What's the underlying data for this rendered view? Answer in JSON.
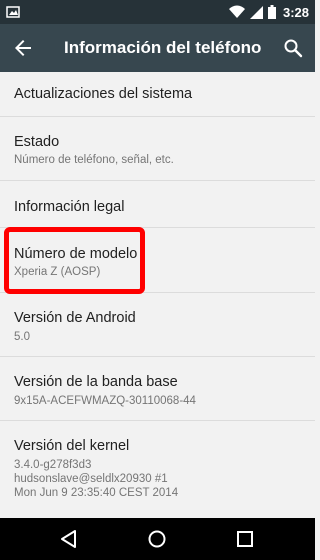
{
  "status_bar": {
    "time": "3:28"
  },
  "toolbar": {
    "title": "Información del teléfono"
  },
  "items": [
    {
      "title": "Actualizaciones del sistema",
      "summary": ""
    },
    {
      "title": "Estado",
      "summary": "Número de teléfono, señal, etc."
    },
    {
      "title": "Información legal",
      "summary": ""
    },
    {
      "title": "Número de modelo",
      "summary": "Xperia Z (AOSP)"
    },
    {
      "title": "Versión de Android",
      "summary": "5.0"
    },
    {
      "title": "Versión de la banda base",
      "summary": "9x15A-ACEFWMAZQ-30110068-44"
    },
    {
      "title": "Versión del kernel",
      "summary_lines": [
        "3.4.0-g278f3d3",
        "hudsonslave@seldlx20930 #1",
        "Mon Jun 9 23:35:40 CEST 2014"
      ]
    }
  ],
  "colors": {
    "status_bar": "#263238",
    "toolbar": "#37474f",
    "highlight": "#ff0000"
  },
  "icons": [
    "notification-image-icon",
    "wifi-icon",
    "cell-signal-icon",
    "battery-icon",
    "back-arrow-icon",
    "search-icon",
    "nav-back-icon",
    "nav-home-icon",
    "nav-recents-icon"
  ]
}
